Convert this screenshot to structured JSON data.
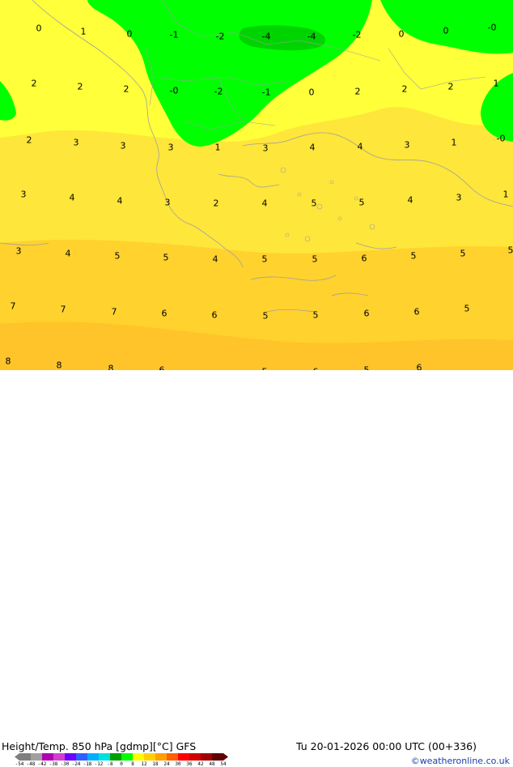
{
  "map": {
    "colors": {
      "yellow_light": "#ffff3a",
      "yellow_mid": "#ffe63a",
      "yellow_deep": "#ffd22e",
      "orange_light": "#ffc42a",
      "green": "#00ff00",
      "green_dark": "#00c800",
      "border": "#a0a0a0",
      "coast": "#a0a0a0"
    },
    "contour_labels": [
      "0",
      "1",
      "0",
      "-1",
      "-2",
      "-4",
      "-4",
      "-2",
      "0",
      "0",
      "-0",
      "2",
      "2",
      "2",
      "-0",
      "-2",
      "-1",
      "0",
      "2",
      "2",
      "2",
      "1",
      "2",
      "3",
      "3",
      "3",
      "1",
      "3",
      "4",
      "4",
      "3",
      "1",
      "-0",
      "3",
      "4",
      "4",
      "3",
      "2",
      "4",
      "5",
      "5",
      "4",
      "3",
      "1",
      "3",
      "4",
      "5",
      "5",
      "4",
      "5",
      "5",
      "6",
      "5",
      "5",
      "5",
      "7",
      "7",
      "7",
      "6",
      "6",
      "5",
      "5",
      "6",
      "6",
      "5",
      "8",
      "8",
      "8",
      "6",
      "5",
      "6",
      "5",
      "6"
    ]
  },
  "footer": {
    "title": "Height/Temp. 850 hPa [gdmp][°C] GFS",
    "datetime": "Tu 20-01-2026 00:00 UTC (00+336)",
    "credit": "©weatheronline.co.uk",
    "colorbar_ticks": [
      "-54",
      "-48",
      "-42",
      "-38",
      "-30",
      "-24",
      "-18",
      "-12",
      "-8",
      "0",
      "8",
      "12",
      "18",
      "24",
      "30",
      "36",
      "42",
      "48",
      "54"
    ],
    "colorbar_colors": [
      "#7f7f7f",
      "#a0a0a0",
      "#b000b0",
      "#d040d0",
      "#6a00ff",
      "#3060ff",
      "#00b0ff",
      "#00e0e0",
      "#00a000",
      "#00ff00",
      "#ffff00",
      "#ffd000",
      "#ffa000",
      "#ff6000",
      "#ff0000",
      "#d00000",
      "#a00000",
      "#600000"
    ]
  }
}
